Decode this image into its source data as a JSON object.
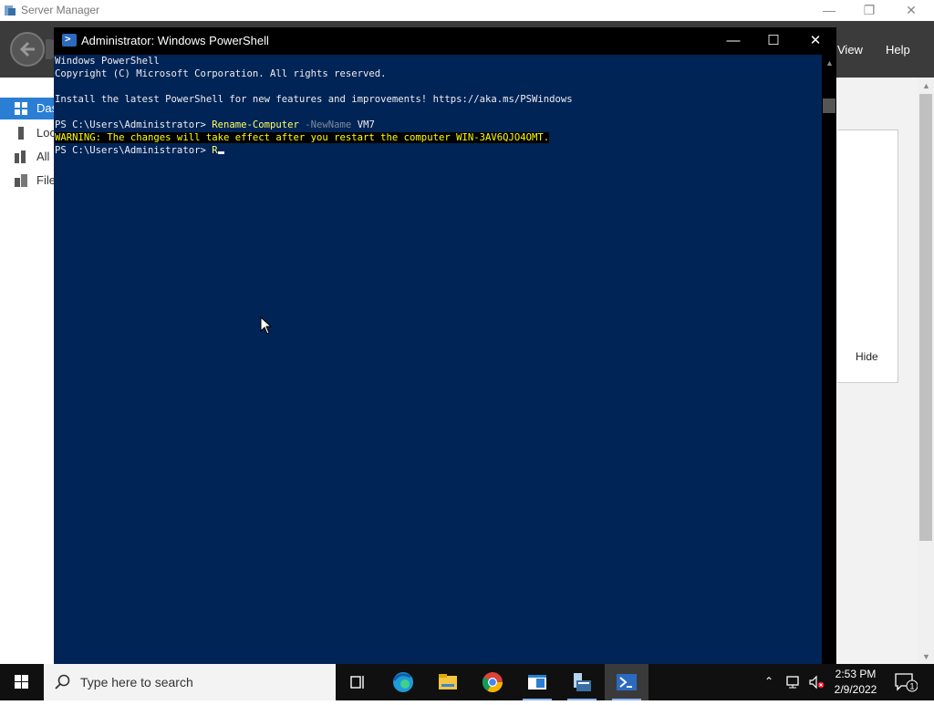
{
  "server_manager": {
    "title": "Server Manager",
    "menu": {
      "view": "View",
      "help": "Help"
    },
    "sidebar": [
      {
        "label": "Das",
        "icon": "dashboard-icon",
        "active": true
      },
      {
        "label": "Loc",
        "icon": "local-server-icon",
        "active": false
      },
      {
        "label": "All",
        "icon": "all-servers-icon",
        "active": false
      },
      {
        "label": "File",
        "icon": "file-services-icon",
        "active": false
      }
    ],
    "hide_label": "Hide"
  },
  "powershell": {
    "title": "Administrator: Windows PowerShell",
    "lines": {
      "l1": "Windows PowerShell",
      "l2": "Copyright (C) Microsoft Corporation. All rights reserved.",
      "l3": "Install the latest PowerShell for new features and improvements! https://aka.ms/PSWindows",
      "prompt": "PS C:\\Users\\Administrator> ",
      "cmd_name": "Rename-Computer",
      "cmd_param": "-NewName",
      "cmd_value": "VM7",
      "warning": "WARNING: The changes will take effect after you restart the computer WIN-3AV6QJO4OMT.",
      "typed": "R"
    }
  },
  "taskbar": {
    "search_placeholder": "Type here to search",
    "apps": [
      "task-view-icon",
      "edge-icon",
      "file-explorer-icon",
      "chrome-icon",
      "app-window-icon",
      "server-manager-icon",
      "powershell-icon"
    ],
    "time": "2:53 PM",
    "date": "2/9/2022",
    "notification_count": "1"
  },
  "colors": {
    "ps_background": "#012456",
    "ps_command": "#ffff66",
    "ps_warning": "#ffff00",
    "sm_header": "#3b3b3b",
    "sm_active": "#2a7fd4"
  }
}
